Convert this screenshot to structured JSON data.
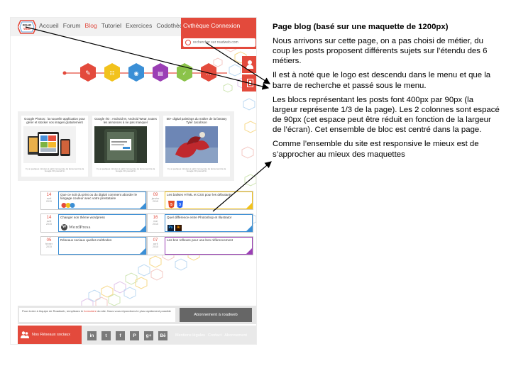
{
  "mockup": {
    "logo_text": "ROAD WEB",
    "nav": [
      "Accueil",
      "Forum",
      "Blog",
      "Tutoriel",
      "Exercices",
      "Codothèque"
    ],
    "nav_active": "Blog",
    "nav_right": [
      "Cvthèque",
      "Connexion"
    ],
    "search_placeholder": "rechercher sur roadweb.com",
    "side_icons": [
      "person-icon",
      "document-icon"
    ],
    "posts": [
      {
        "title": "Google Photos : la nouvelle application pour gérer et stocker vos images gratuitement",
        "footer": "Il y a quelques minutes à partir, la keynote de lancement de la Google I/O prenait fin"
      },
      {
        "title": "Google I/O : Android M, Android Wear, toutes les annonces à ne pas manquer",
        "footer": "Il y a quelques minutes à partir, la keynote de lancement de la Google I/O prenait fin"
      },
      {
        "title": "50+ digital paintings du maître de la fantasy Tyler Jacobson",
        "footer": "Il y a quelques minutes à partir, la keynote de lancement de la Google I/O prenait fin"
      }
    ],
    "cards_left": [
      {
        "day": "14",
        "month": "avril",
        "year": "2015",
        "title": "Que ce soit du print ou du digital comment aborder le langage couleur avec votre prestataire",
        "accent": "#3b8fd6"
      },
      {
        "day": "14",
        "month": "avril",
        "year": "2015",
        "title": "Changer son thème wordpress",
        "brand": "WordPress",
        "accent": "#3b8fd6"
      },
      {
        "day": "05",
        "month": "février",
        "year": "2015",
        "title": "Réseaux sociaux quelles méthodes",
        "accent": "#3b8fd6"
      }
    ],
    "cards_right": [
      {
        "day": "09",
        "month": "janvier",
        "year": "2015",
        "title": "Les balises HTML et CSS pour les débutants",
        "accent": "#f2c21c"
      },
      {
        "day": "16",
        "month": "mai",
        "year": "2015",
        "title": "Quel différence entre Photoshop et Illustrator",
        "icons": [
          "Ps",
          "Ai"
        ],
        "accent": "#3b8fd6"
      },
      {
        "day": "07",
        "month": "avril",
        "year": "2015",
        "title": "Les bon reflexes pour une bon référencement",
        "accent": "#9b3fb5"
      }
    ],
    "footer_text_1": "Pour écrire à léquipe de Roadweb, remplissez le ",
    "footer_link": "formulaire",
    "footer_text_2": " du site. Nous vous répondrons le plus rapidement possible",
    "subscribe_label": "Abonnement à roadweb",
    "social_label": "Nos Réseaux sociaux",
    "social_icons": [
      "in",
      "t",
      "f",
      "P",
      "g+",
      "Bē"
    ],
    "footer_links": [
      "Mentions légales",
      "Contact",
      "Abonnement"
    ]
  },
  "notes": {
    "title": "Page blog (basé sur une maquette de 1200px)",
    "p1": "Nous arrivons sur cette page, on a pas choisi de métier, du coup les posts proposent différents sujets sur l’étendu des 6 métiers.",
    "p2": "Il est à noté que le logo est descendu dans le menu et que la barre de recherche et passé sous le menu.",
    "p3": "Les blocs représentant les posts font 400px par 90px (la largeur représente 1/3 de la page). Les 2 colonnes sont espacé de 90px (cet espace peut être réduit en fonction de la largeur de l’écran). Cet ensemble de bloc est centré dans la page.",
    "p4": "Comme l’ensemble du site est responsive le mieux est de s’approcher au mieux des maquettes"
  },
  "colors": {
    "brand_red": "#e34a3c",
    "hex_colors": [
      "#e34a3c",
      "#f2c21c",
      "#3b8fd6",
      "#9b3fb5",
      "#8bc34a",
      "#e34a3c"
    ]
  }
}
